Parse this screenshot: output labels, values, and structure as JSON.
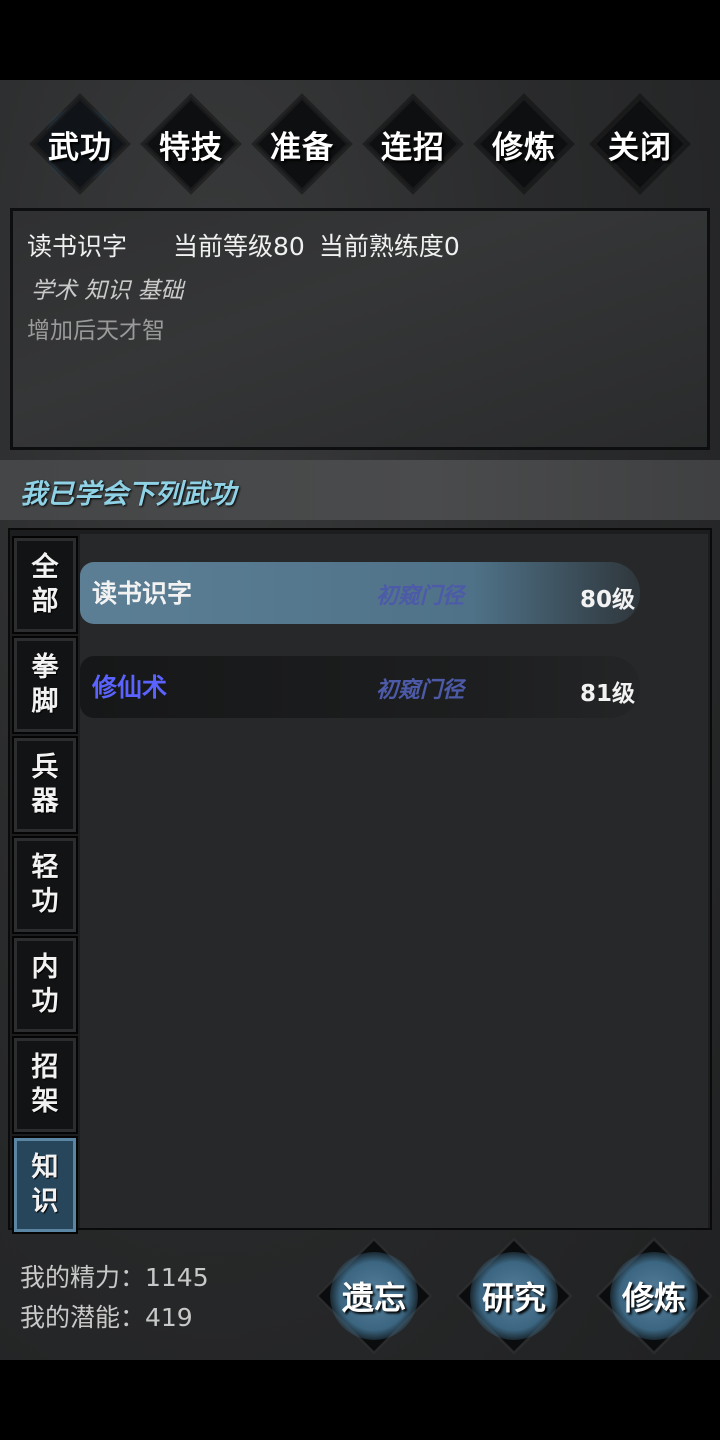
{
  "tabs": [
    {
      "label": "武功",
      "active": true
    },
    {
      "label": "特技",
      "active": false
    },
    {
      "label": "准备",
      "active": false
    },
    {
      "label": "连招",
      "active": false
    },
    {
      "label": "修炼",
      "active": false
    },
    {
      "label": "关闭",
      "active": false
    }
  ],
  "info": {
    "skill_name": "读书识字",
    "current_level": "当前等级80",
    "current_proficiency": "当前熟练度0",
    "tags": "学术 知识 基础",
    "description": "增加后天才智"
  },
  "learned_heading": "我已学会下列武功",
  "categories": [
    {
      "line1": "全",
      "line2": "部",
      "active": false
    },
    {
      "line1": "拳",
      "line2": "脚",
      "active": false
    },
    {
      "line1": "兵",
      "line2": "器",
      "active": false
    },
    {
      "line1": "轻",
      "line2": "功",
      "active": false
    },
    {
      "line1": "内",
      "line2": "功",
      "active": false
    },
    {
      "line1": "招",
      "line2": "架",
      "active": false
    },
    {
      "line1": "知",
      "line2": "识",
      "active": true
    }
  ],
  "skills": [
    {
      "name": "读书识字",
      "realm": "初窥门径",
      "level": "80级",
      "selected": true,
      "name_color": "#f2f2f2"
    },
    {
      "name": "修仙术",
      "realm": "初窥门径",
      "level": "81级",
      "selected": false,
      "name_color": "#5a63ff"
    }
  ],
  "stats": {
    "energy": "我的精力：1145",
    "potential": "我的潜能：419"
  },
  "actions": {
    "forget": "遗忘",
    "research": "研究",
    "practice": "修炼"
  },
  "colors": {
    "accent_blue": "#4f7d9e",
    "heading_cyan": "#8fd2e6",
    "realm_purple": "#4c5aa8"
  }
}
